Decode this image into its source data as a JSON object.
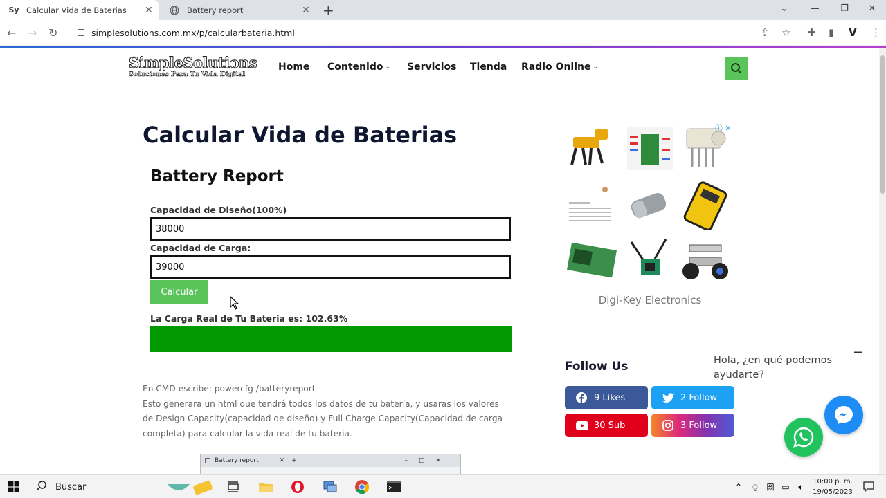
{
  "browser": {
    "tabs": [
      {
        "label": "Calcular Vida de Baterias",
        "favicon": "Sy",
        "active": true
      },
      {
        "label": "Battery report",
        "favicon": "globe-icon",
        "active": false
      }
    ],
    "url": "simplesolutions.com.mx/p/calcularbateria.html"
  },
  "site": {
    "logo_line1": "SimpleSolutions",
    "logo_line2": "Soluciones Para Tu Vida Digital",
    "nav": [
      "Home",
      "Contenido",
      "Servicios",
      "Tienda",
      "Radio Online"
    ],
    "accent": "#5ac45a"
  },
  "main": {
    "page_title": "Calcular Vida de Baterias",
    "report_title": "Battery Report",
    "design_label": "Capacidad de Diseño(100%)",
    "design_value": "38000",
    "charge_label": "Capacidad de Carga:",
    "charge_value": "39000",
    "calc_button": "Calcular",
    "result_text": "La Carga Real de Tu Bateria es: 102.63%",
    "result_fraction": 1.0,
    "para_line1": "En CMD escribe: powercfg /batteryreport",
    "para_line2": "Esto generara un html que tendrá todos los datos de tu batería, y usaras los valores de Design Capacity(capacidad de diseño) y Full Charge Capacity(Capacidad de carga completa) para calcular la vida real de tu bateria.",
    "mini_tab": "Battery report"
  },
  "sidebar": {
    "ad_credit": "Digi-Key Electronics",
    "follow_title": "Follow Us",
    "social": [
      {
        "label": "9 Likes",
        "icon": "facebook-icon",
        "color": "#3b5998"
      },
      {
        "label": "2 Follow",
        "icon": "twitter-icon",
        "color": "#1da1f2"
      },
      {
        "label": "30 Sub",
        "icon": "youtube-icon",
        "color": "#e0001b"
      },
      {
        "label": "3 Follow",
        "icon": "instagram-icon",
        "color": "#c13584"
      }
    ]
  },
  "chat": {
    "message": "Hola, ¿en qué podemos ayudarte?"
  },
  "taskbar": {
    "search_placeholder": "Buscar",
    "time": "10:00 p. m.",
    "date": "19/05/2023"
  }
}
